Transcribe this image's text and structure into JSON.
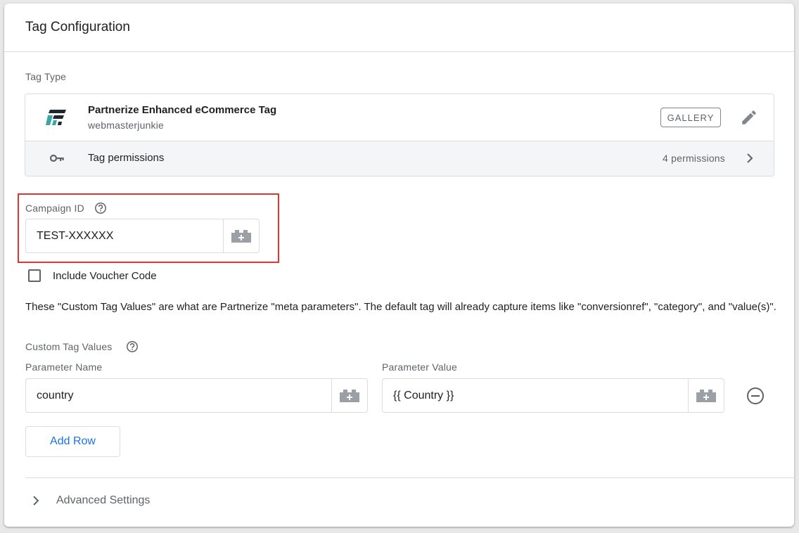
{
  "card": {
    "title": "Tag Configuration"
  },
  "tag_type": {
    "section_label": "Tag Type",
    "name": "Partnerize Enhanced eCommerce Tag",
    "vendor": "webmasterjunkie",
    "gallery_label": "GALLERY",
    "permissions_label": "Tag permissions",
    "permissions_count": "4 permissions",
    "logo_icon": "partnerize-logo",
    "edit_icon": "pencil-icon",
    "key_icon": "key-icon"
  },
  "campaign": {
    "label": "Campaign ID",
    "value": "TEST-XXXXXX"
  },
  "voucher": {
    "label": "Include Voucher Code",
    "checked": false
  },
  "description": "These \"Custom Tag Values\" are what are Partnerize \"meta parameters\". The default tag will already capture items like \"conversionref\", \"category\", and \"value(s)\".",
  "custom_values": {
    "label": "Custom Tag Values",
    "param_name_header": "Parameter Name",
    "param_value_header": "Parameter Value",
    "rows": [
      {
        "name": "country",
        "value": "{{ Country }}"
      }
    ],
    "add_row_label": "Add Row"
  },
  "advanced": {
    "label": "Advanced Settings"
  },
  "colors": {
    "highlight": "#e3342f",
    "link_blue": "#1a73e8",
    "logo_teal": "#3aa6a4",
    "logo_dark": "#1d2731"
  }
}
